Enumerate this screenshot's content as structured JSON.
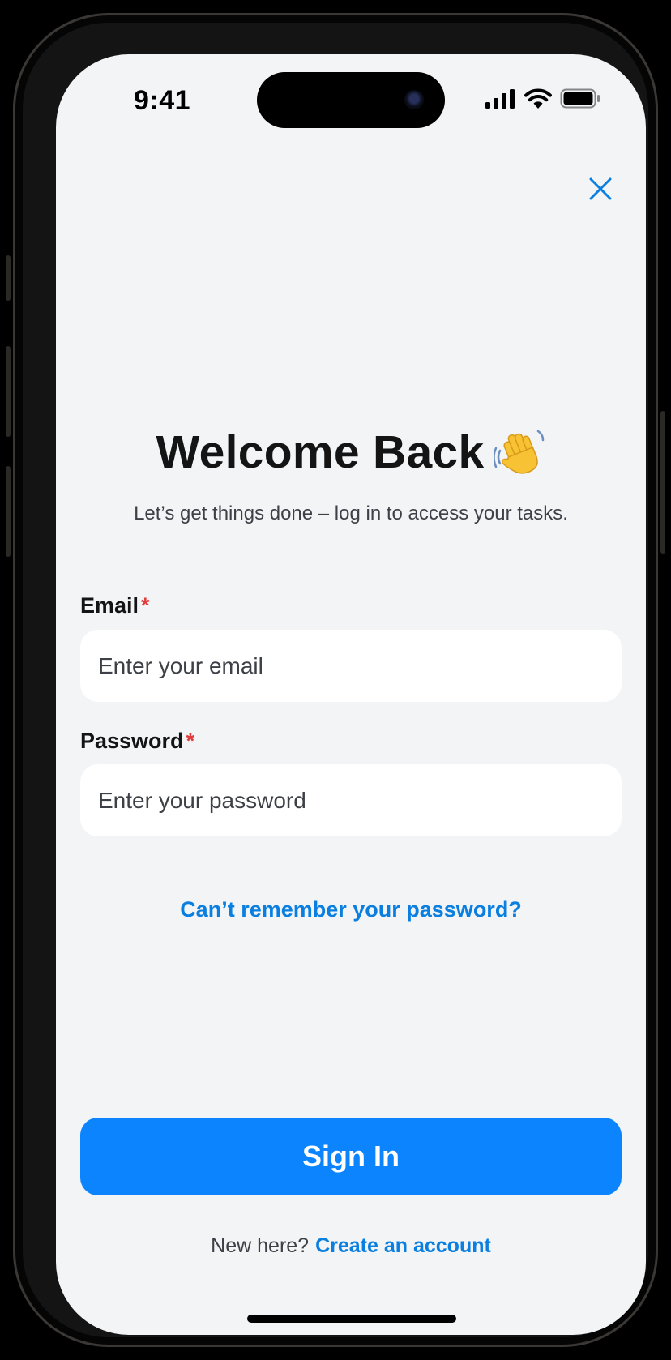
{
  "status_bar": {
    "time": "9:41",
    "icons": [
      "cellular-signal-icon",
      "wifi-icon",
      "battery-icon"
    ]
  },
  "header": {
    "close_icon": "close-icon"
  },
  "welcome": {
    "title": "Welcome Back",
    "emoji": "👋",
    "subtitle": "Let’s get things done – log in to access your tasks."
  },
  "form": {
    "email": {
      "label": "Email",
      "required_mark": "*",
      "value": "",
      "placeholder": "Enter your email"
    },
    "password": {
      "label": "Password",
      "required_mark": "*",
      "value": "",
      "placeholder": "Enter your password"
    },
    "forgot_link": "Can’t remember your password?",
    "submit_label": "Sign In"
  },
  "footer": {
    "prompt": "New here?",
    "create_link": "Create an account"
  },
  "colors": {
    "accent": "#0b84fe",
    "link": "#0a7fe0",
    "required": "#e23b3b",
    "background": "#f2f4f6"
  }
}
